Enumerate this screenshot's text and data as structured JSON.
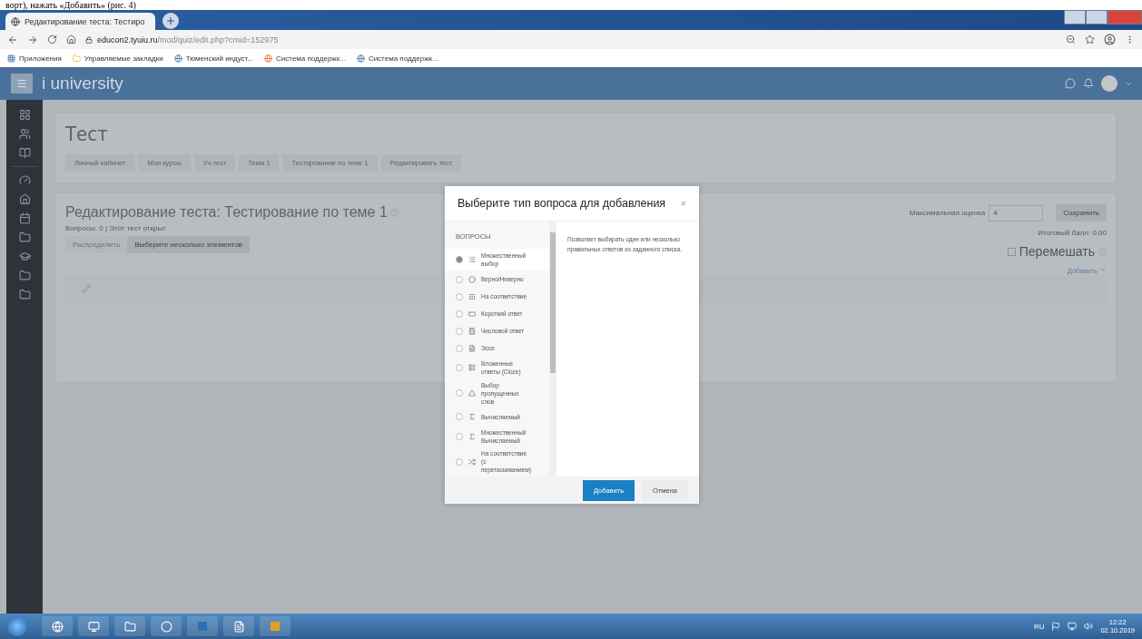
{
  "document_text": "ворт), нажать «Добавить» (рис. 4)",
  "browser": {
    "tab_title": "Редактирование теста: Тестиро",
    "url_host": "educon2.tyuiu.ru",
    "url_path": "/mod/quiz/edit.php?cmid=152975",
    "bookmarks": [
      {
        "label": "Приложения"
      },
      {
        "label": "Управляемые закладки"
      },
      {
        "label": "Тюменский индуст..."
      },
      {
        "label": "Система поддержк..."
      },
      {
        "label": "Система поддержк..."
      }
    ]
  },
  "navbar": {
    "brand_mark": "i",
    "brand": "university"
  },
  "page": {
    "title": "Тест",
    "breadcrumbs": [
      "Личный кабинет",
      "Мои курсы",
      "Уч-тест",
      "Тема 1",
      "Тестирование по теме 1",
      "Редактировать тест"
    ],
    "heading": "Редактирование теста: Тестирование по теме 1",
    "status": "Вопросы: 0 | Этот тест открыт",
    "buttons": [
      {
        "label": "Распределить",
        "disabled": true
      },
      {
        "label": "Выберите несколько элементов",
        "disabled": false
      }
    ],
    "max_grade_label": "Максимальная оценка",
    "max_grade": "4",
    "save": "Сохранить",
    "total": "Итоговый балл: 0,00",
    "shuffle_label": "Перемешать",
    "shuffle_checked": false,
    "add_link": "Добавить"
  },
  "modal": {
    "title": "Выберите тип вопроса для добавления",
    "close": "×",
    "section": "ВОПРОСЫ",
    "description": "Позволяет выбирать один или несколько правильных ответов из заданного списка.",
    "questions": [
      {
        "label": "Множественный выбор",
        "selected": true
      },
      {
        "label": "Верно/Неверно",
        "selected": false
      },
      {
        "label": "На соответствие",
        "selected": false
      },
      {
        "label": "Короткий ответ",
        "selected": false
      },
      {
        "label": "Числовой ответ",
        "selected": false
      },
      {
        "label": "Эссе",
        "selected": false
      },
      {
        "label": "Вложенные ответы (Cloze)",
        "selected": false
      },
      {
        "label": "Выбор пропущенных слов",
        "selected": false
      },
      {
        "label": "Вычисляемый",
        "selected": false
      },
      {
        "label": "Множественный Вычисляемый",
        "selected": false
      },
      {
        "label": "На соответствие (с перетаскиванием)",
        "selected": false
      }
    ],
    "add": "Добавить",
    "cancel": "Отмена"
  },
  "taskbar": {
    "lang": "RU",
    "time": "12:22",
    "date": "02.10.2019"
  }
}
